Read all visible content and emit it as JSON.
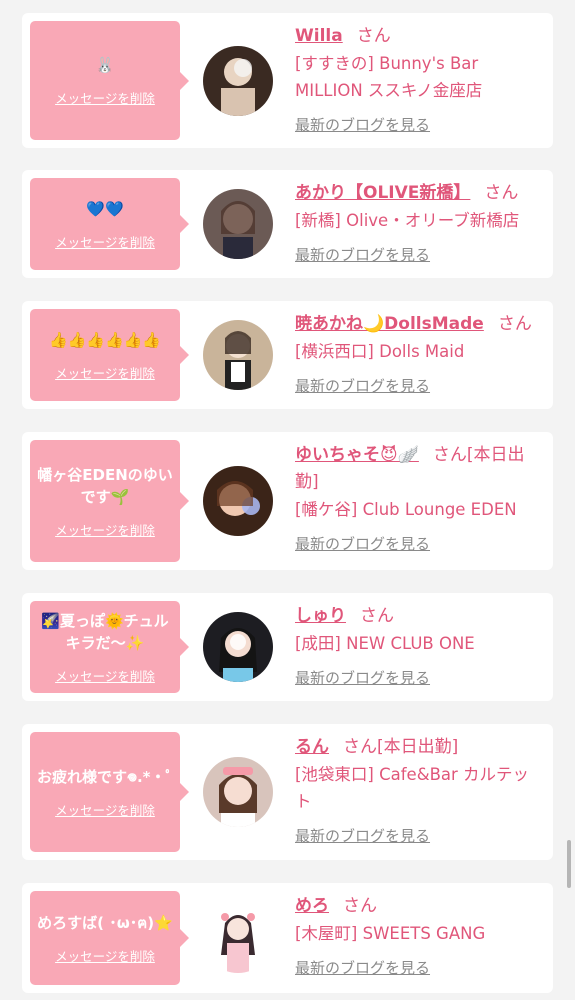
{
  "colors": {
    "accent": "#e0567a",
    "bubble": "#f9a8b6",
    "muted": "#8a8a8a"
  },
  "delete_label": "メッセージを削除",
  "blog_label": "最新のブログを見る",
  "san_label": "さん",
  "items": [
    {
      "message": "🐰",
      "name": "Willa",
      "suffix": "さん",
      "shop": "[すすきの] Bunny's Bar MILLION ススキノ金座店"
    },
    {
      "message": "💙💙",
      "name": "あかり【OLIVE新橋】",
      "suffix": "さん",
      "shop": "[新橋] Olive・オリーブ新橋店"
    },
    {
      "message": "👍👍👍👍👍👍",
      "name": "暁あかね🌙DollsMade",
      "suffix": "さん",
      "shop": "[横浜西口] Dolls Maid"
    },
    {
      "message": "幡ヶ谷EDENのゆいです🌱",
      "name": "ゆいちゃそ😈🪽",
      "suffix": "さん[本日出勤]",
      "shop": "[幡ケ谷] Club Lounge EDEN"
    },
    {
      "message": "🌠夏っぽ🌞チュルキラだ〜✨",
      "name": "しゅり",
      "suffix": "さん",
      "shop": "[成田] NEW CLUB ONE"
    },
    {
      "message": "お疲れ様です𖦹.*・ﾟ",
      "name": "るん",
      "suffix": "さん[本日出勤]",
      "shop": "[池袋東口] Cafe&Bar カルテット"
    },
    {
      "message": "めろすば( ･ω･ฅ)⭐",
      "name": "めろ",
      "suffix": "さん",
      "shop": "[木屋町] SWEETS GANG"
    }
  ]
}
